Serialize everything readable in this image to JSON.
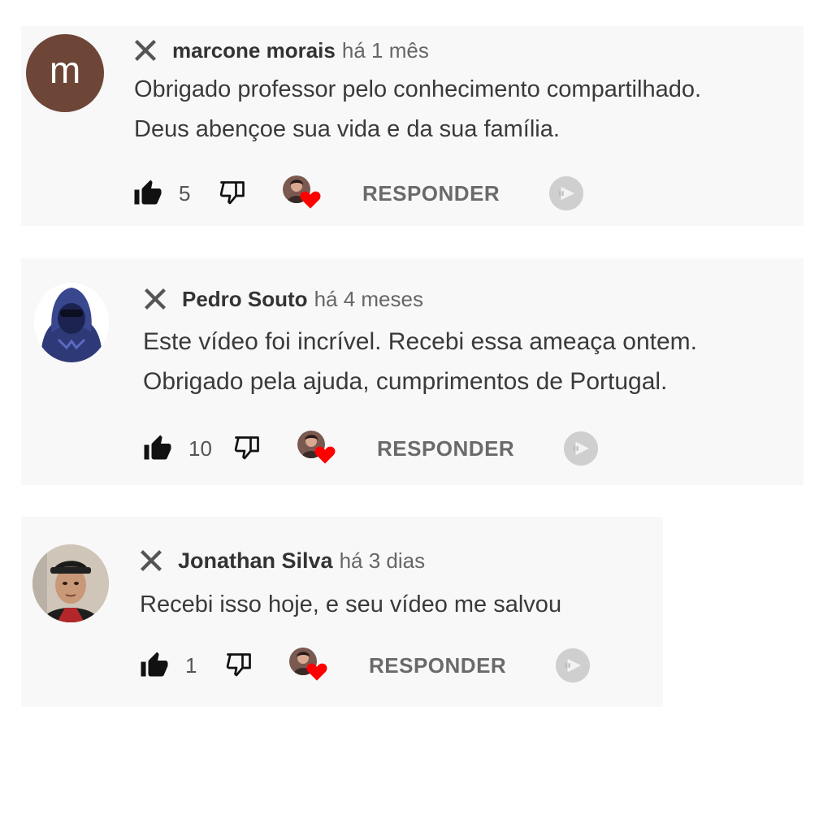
{
  "reply_label": "RESPONDER",
  "colors": {
    "heart": "#ff0000",
    "panel": "#f8f8f8",
    "author": "#333333",
    "meta": "#666666"
  },
  "comments": [
    {
      "avatar_letter": "m",
      "author": "marcone morais",
      "time": "há 1 mês",
      "lines": [
        "Obrigado professor pelo conhecimento compartilhado.",
        "Deus abençoe sua vida e da sua família."
      ],
      "likes": "5"
    },
    {
      "author": "Pedro Souto",
      "time": "há 4 meses",
      "lines": [
        "Este vídeo foi incrível. Recebi essa ameaça ontem.",
        "Obrigado pela ajuda, cumprimentos de Portugal."
      ],
      "likes": "10"
    },
    {
      "author": "Jonathan Silva",
      "time": "há 3 dias",
      "lines": [
        "Recebi isso hoje, e seu vídeo me salvou"
      ],
      "likes": "1"
    }
  ]
}
